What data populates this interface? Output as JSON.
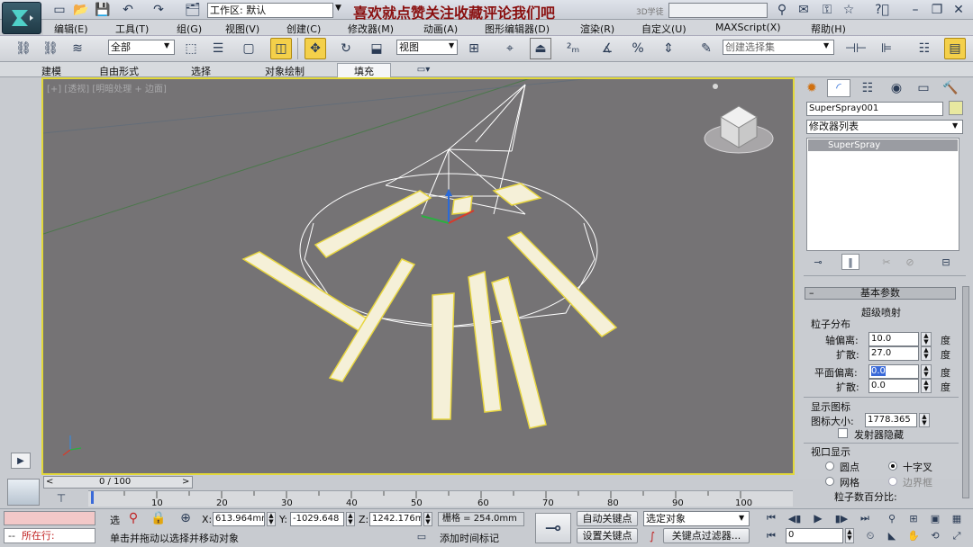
{
  "title_bar": {
    "workspace_label": "工作区: 默认",
    "overlay_text": "喜欢就点赞关注收藏评论我们吧",
    "overlay_suffix": "3D学徒"
  },
  "menu": {
    "items": [
      "编辑(E)",
      "工具(T)",
      "组(G)",
      "视图(V)",
      "创建(C)",
      "修改器(M)",
      "动画(A)",
      "图形编辑器(D)",
      "渲染(R)",
      "自定义(U)",
      "MAXScript(X)",
      "帮助(H)"
    ]
  },
  "toolbar": {
    "selection_filter": "全部",
    "ref_coord": "视图",
    "named_selection": "创建选择集"
  },
  "ribbon": {
    "tabs": [
      "建模",
      "自由形式",
      "选择",
      "对象绘制",
      "填充"
    ],
    "active_tab": "填充"
  },
  "viewport": {
    "label": "[+] [透视] [明暗处理 + 边面]"
  },
  "panel": {
    "object_name": "SuperSpray001",
    "modifier_list": "修改器列表",
    "stack_item": "SuperSpray",
    "rollout_title": "基本参数",
    "group_title": "超级喷射",
    "particle_distribution": "粒子分布",
    "axis_offset_label": "轴偏离:",
    "axis_offset_value": "10.0",
    "spread_label": "扩散:",
    "spread_value": "27.0",
    "plane_offset_label": "平面偏离:",
    "plane_offset_value": "0.0",
    "plane_spread_label": "扩散:",
    "plane_spread_value": "0.0",
    "deg": "度",
    "display_icon": "显示图标",
    "icon_size_label": "图标大小:",
    "icon_size_value": "1778.365",
    "emitter_hide": "发射器隐藏",
    "viewport_display": "视口显示",
    "dots": "圆点",
    "ticks": "十字叉",
    "mesh": "网格",
    "bbox": "边界框",
    "percent": "粒子数百分比:"
  },
  "timeline": {
    "frame": "0 / 100",
    "ticks": [
      "10",
      "20",
      "30",
      "40",
      "50",
      "60",
      "70",
      "80",
      "90",
      "100"
    ],
    "frame_progress": 0
  },
  "status": {
    "running": "所在行:",
    "select_mode": "选",
    "x_label": "X:",
    "x_value": "613.964mm",
    "y_label": "Y:",
    "y_value": "-1029.648",
    "z_label": "Z:",
    "z_value": "1242.176m",
    "grid": "栅格 = 254.0mm",
    "auto_key": "自动关键点",
    "set_key": "设置关键点",
    "selected": "选定对象",
    "key_filter": "关键点过滤器...",
    "prompt": "单击并拖动以选择并移动对象",
    "add_time_tag": "添加时间标记",
    "frame_field": "0"
  }
}
